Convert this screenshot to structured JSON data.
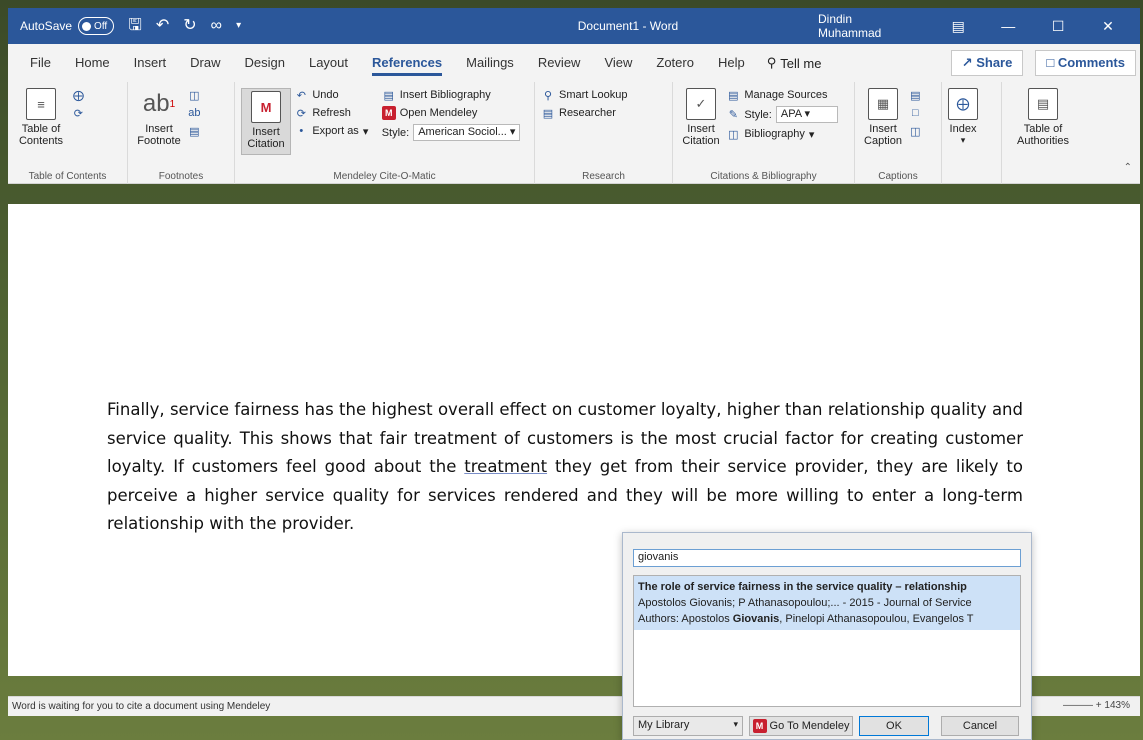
{
  "titlebar": {
    "autosave_label": "AutoSave",
    "autosave_state": "Off",
    "document_title": "Document1 - Word",
    "user": "Dindin Muhammad"
  },
  "tabs": [
    "File",
    "Home",
    "Insert",
    "Draw",
    "Design",
    "Layout",
    "References",
    "Mailings",
    "Review",
    "View",
    "Zotero",
    "Help"
  ],
  "active_tab": "References",
  "tell_me": "Tell me",
  "share_label": "Share",
  "comments_label": "Comments",
  "ribbon": {
    "toc": {
      "button": "Table of Contents",
      "group": "Table of Contents"
    },
    "footnotes": {
      "button": "Insert Footnote",
      "group": "Footnotes"
    },
    "mendeley": {
      "insert_citation": "Insert Citation",
      "undo": "Undo",
      "refresh": "Refresh",
      "export_as": "Export as",
      "insert_bibliography": "Insert Bibliography",
      "open_mendeley": "Open Mendeley",
      "style_label": "Style:",
      "style_value": "American Sociol...",
      "group": "Mendeley Cite-O-Matic"
    },
    "research": {
      "smart_lookup": "Smart Lookup",
      "researcher": "Researcher",
      "group": "Research"
    },
    "citations": {
      "insert_citation": "Insert Citation",
      "manage_sources": "Manage Sources",
      "style_label": "Style:",
      "style_value": "APA",
      "bibliography": "Bibliography",
      "group": "Citations & Bibliography"
    },
    "captions": {
      "button": "Insert Caption",
      "group": "Captions"
    },
    "index": {
      "button": "Index"
    },
    "authorities": {
      "button": "Table of Authorities"
    }
  },
  "document": {
    "p1": "Finally, service fairness has the highest overall effect on customer loyalty, higher than relationship quality and service quality. This shows that fair treatment of customers is the most crucial factor for creating customer loyalty. If customers feel good about the ",
    "p_underlined": "treatment",
    "p2": " they get from their service provider, they are likely to perceive a higher service quality for services rendered and they will be more willing to enter a long-term relationship with the provider."
  },
  "status": {
    "message": "Word is waiting for you to cite a document using Mendeley",
    "zoom": "143%"
  },
  "popup": {
    "search_value": "giovanis",
    "result": {
      "title": "The role of service fairness in the service quality – relationship",
      "meta": "Apostolos Giovanis; P Athanasopoulou;... - 2015 - Journal of Service",
      "authors_prefix": "Authors: Apostolos ",
      "authors_bold": "Giovanis",
      "authors_suffix": ", Pinelopi Athanasopoulou, Evangelos T"
    },
    "library": "My Library",
    "go_to_mendeley": "Go To Mendeley",
    "ok": "OK",
    "cancel": "Cancel"
  }
}
